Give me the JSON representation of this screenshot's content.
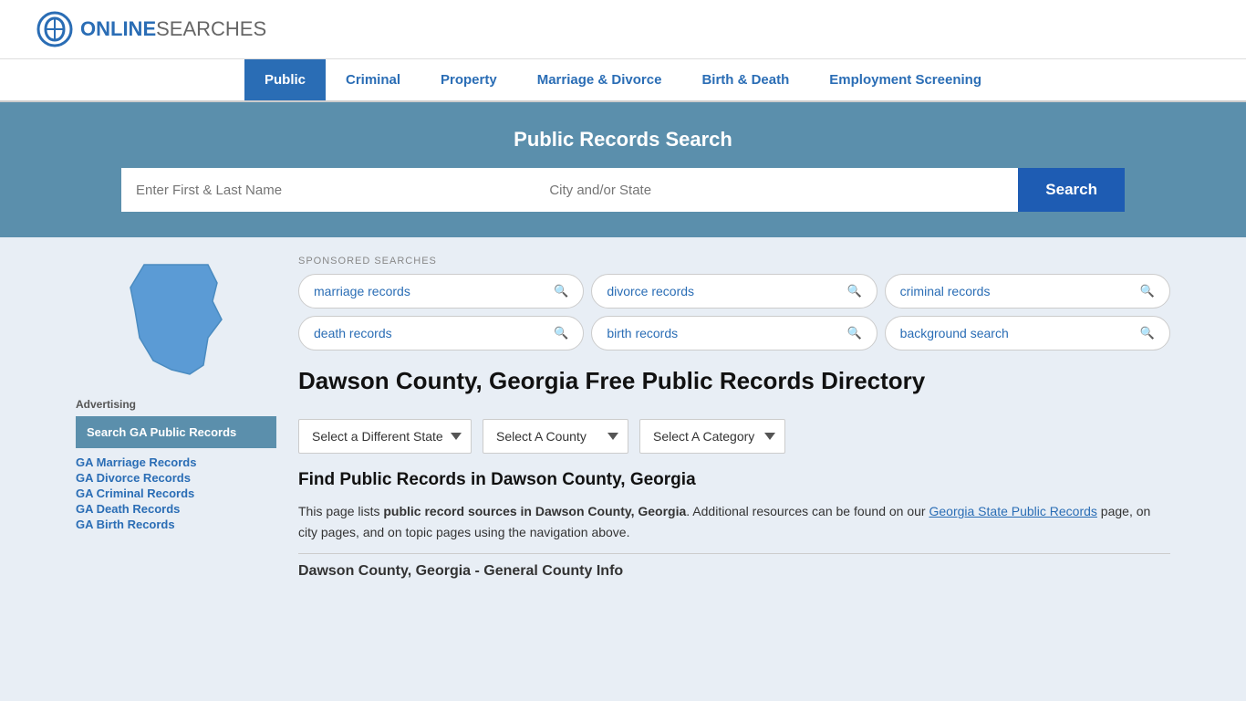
{
  "header": {
    "logo_online": "ONLINE",
    "logo_searches": "SEARCHES"
  },
  "nav": {
    "items": [
      {
        "label": "Public",
        "active": true
      },
      {
        "label": "Criminal",
        "active": false
      },
      {
        "label": "Property",
        "active": false
      },
      {
        "label": "Marriage & Divorce",
        "active": false
      },
      {
        "label": "Birth & Death",
        "active": false
      },
      {
        "label": "Employment Screening",
        "active": false
      }
    ]
  },
  "search_banner": {
    "title": "Public Records Search",
    "name_placeholder": "Enter First & Last Name",
    "city_placeholder": "City and/or State",
    "button_label": "Search"
  },
  "sponsored": {
    "label": "SPONSORED SEARCHES",
    "items": [
      {
        "label": "marriage records"
      },
      {
        "label": "divorce records"
      },
      {
        "label": "criminal records"
      },
      {
        "label": "death records"
      },
      {
        "label": "birth records"
      },
      {
        "label": "background search"
      }
    ]
  },
  "sidebar": {
    "ad_label": "Advertising",
    "ad_box_text": "Search GA Public Records",
    "links": [
      {
        "label": "GA Marriage Records"
      },
      {
        "label": "GA Divorce Records"
      },
      {
        "label": "GA Criminal Records"
      },
      {
        "label": "GA Death Records"
      },
      {
        "label": "GA Birth Records"
      }
    ]
  },
  "directory": {
    "title": "Dawson County, Georgia Free Public Records Directory",
    "dropdowns": {
      "state": "Select a Different State",
      "county": "Select A County",
      "category": "Select A Category"
    }
  },
  "find_records": {
    "heading": "Find Public Records in Dawson County, Georgia",
    "paragraph": "This page lists public record sources in Dawson County, Georgia. Additional resources can be found on our Georgia State Public Records page, on city pages, and on topic pages using the navigation above.",
    "general_info_heading": "Dawson County, Georgia - General County Info"
  }
}
